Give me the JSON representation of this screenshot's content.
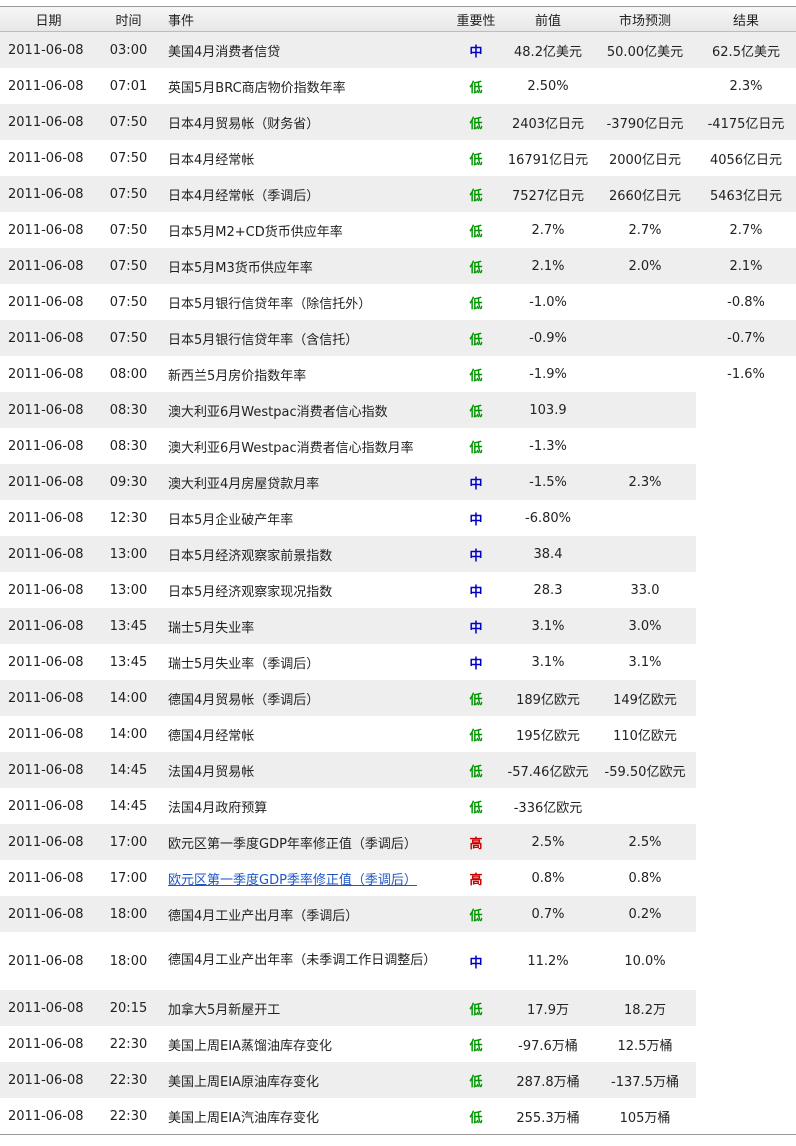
{
  "headers": {
    "date": "日期",
    "time": "时间",
    "event": "事件",
    "importance": "重要性",
    "previous": "前值",
    "forecast": "市场预测",
    "result": "结果"
  },
  "colors": {
    "low": "#009900",
    "medium": "#0000cc",
    "high": "#cc0000",
    "link": "#1e56c8"
  },
  "rows": [
    {
      "date": "2011-06-08",
      "time": "03:00",
      "event": "美国4月消费者信贷",
      "importance": "中",
      "level": "mid",
      "previous": "48.2亿美元",
      "forecast": "50.00亿美元",
      "result": "62.5亿美元"
    },
    {
      "date": "2011-06-08",
      "time": "07:01",
      "event": "英国5月BRC商店物价指数年率",
      "importance": "低",
      "level": "low",
      "previous": "2.50%",
      "forecast": "",
      "result": "2.3%"
    },
    {
      "date": "2011-06-08",
      "time": "07:50",
      "event": "日本4月贸易帐（财务省）",
      "importance": "低",
      "level": "low",
      "previous": "2403亿日元",
      "forecast": "-3790亿日元",
      "result": "-4175亿日元"
    },
    {
      "date": "2011-06-08",
      "time": "07:50",
      "event": "日本4月经常帐",
      "importance": "低",
      "level": "low",
      "previous": "16791亿日元",
      "forecast": "2000亿日元",
      "result": "4056亿日元"
    },
    {
      "date": "2011-06-08",
      "time": "07:50",
      "event": "日本4月经常帐（季调后）",
      "importance": "低",
      "level": "low",
      "previous": "7527亿日元",
      "forecast": "2660亿日元",
      "result": "5463亿日元"
    },
    {
      "date": "2011-06-08",
      "time": "07:50",
      "event": "日本5月M2+CD货币供应年率",
      "importance": "低",
      "level": "low",
      "previous": "2.7%",
      "forecast": "2.7%",
      "result": "2.7%"
    },
    {
      "date": "2011-06-08",
      "time": "07:50",
      "event": "日本5月M3货币供应年率",
      "importance": "低",
      "level": "low",
      "previous": "2.1%",
      "forecast": "2.0%",
      "result": "2.1%"
    },
    {
      "date": "2011-06-08",
      "time": "07:50",
      "event": "日本5月银行信贷年率（除信托外）",
      "importance": "低",
      "level": "low",
      "previous": "-1.0%",
      "forecast": "",
      "result": "-0.8%"
    },
    {
      "date": "2011-06-08",
      "time": "07:50",
      "event": "日本5月银行信贷年率（含信托）",
      "importance": "低",
      "level": "low",
      "previous": "-0.9%",
      "forecast": "",
      "result": "-0.7%"
    },
    {
      "date": "2011-06-08",
      "time": "08:00",
      "event": "新西兰5月房价指数年率",
      "importance": "低",
      "level": "low",
      "previous": "-1.9%",
      "forecast": "",
      "result": "-1.6%"
    },
    {
      "date": "2011-06-08",
      "time": "08:30",
      "event": "澳大利亚6月Westpac消费者信心指数",
      "importance": "低",
      "level": "low",
      "previous": "103.9",
      "forecast": "",
      "result": ""
    },
    {
      "date": "2011-06-08",
      "time": "08:30",
      "event": "澳大利亚6月Westpac消费者信心指数月率",
      "importance": "低",
      "level": "low",
      "previous": "-1.3%",
      "forecast": "",
      "result": ""
    },
    {
      "date": "2011-06-08",
      "time": "09:30",
      "event": "澳大利亚4月房屋贷款月率",
      "importance": "中",
      "level": "mid",
      "previous": "-1.5%",
      "forecast": "2.3%",
      "result": ""
    },
    {
      "date": "2011-06-08",
      "time": "12:30",
      "event": "日本5月企业破产年率",
      "importance": "中",
      "level": "mid",
      "previous": "-6.80%",
      "forecast": "",
      "result": ""
    },
    {
      "date": "2011-06-08",
      "time": "13:00",
      "event": "日本5月经济观察家前景指数",
      "importance": "中",
      "level": "mid",
      "previous": "38.4",
      "forecast": "",
      "result": ""
    },
    {
      "date": "2011-06-08",
      "time": "13:00",
      "event": "日本5月经济观察家现况指数",
      "importance": "中",
      "level": "mid",
      "previous": "28.3",
      "forecast": "33.0",
      "result": ""
    },
    {
      "date": "2011-06-08",
      "time": "13:45",
      "event": "瑞士5月失业率",
      "importance": "中",
      "level": "mid",
      "previous": "3.1%",
      "forecast": "3.0%",
      "result": ""
    },
    {
      "date": "2011-06-08",
      "time": "13:45",
      "event": "瑞士5月失业率（季调后）",
      "importance": "中",
      "level": "mid",
      "previous": "3.1%",
      "forecast": "3.1%",
      "result": ""
    },
    {
      "date": "2011-06-08",
      "time": "14:00",
      "event": "德国4月贸易帐（季调后）",
      "importance": "低",
      "level": "low",
      "previous": "189亿欧元",
      "forecast": "149亿欧元",
      "result": ""
    },
    {
      "date": "2011-06-08",
      "time": "14:00",
      "event": "德国4月经常帐",
      "importance": "低",
      "level": "low",
      "previous": "195亿欧元",
      "forecast": "110亿欧元",
      "result": ""
    },
    {
      "date": "2011-06-08",
      "time": "14:45",
      "event": "法国4月贸易帐",
      "importance": "低",
      "level": "low",
      "previous": "-57.46亿欧元",
      "forecast": "-59.50亿欧元",
      "result": ""
    },
    {
      "date": "2011-06-08",
      "time": "14:45",
      "event": "法国4月政府预算",
      "importance": "低",
      "level": "low",
      "previous": "-336亿欧元",
      "forecast": "",
      "result": ""
    },
    {
      "date": "2011-06-08",
      "time": "17:00",
      "event": "欧元区第一季度GDP年率修正值（季调后）",
      "importance": "高",
      "level": "high",
      "previous": "2.5%",
      "forecast": "2.5%",
      "result": ""
    },
    {
      "date": "2011-06-08",
      "time": "17:00",
      "event": "欧元区第一季度GDP季率修正值（季调后）",
      "importance": "高",
      "level": "high",
      "previous": "0.8%",
      "forecast": "0.8%",
      "result": "",
      "link": true
    },
    {
      "date": "2011-06-08",
      "time": "18:00",
      "event": "德国4月工业产出月率（季调后）",
      "importance": "低",
      "level": "low",
      "previous": "0.7%",
      "forecast": "0.2%",
      "result": ""
    },
    {
      "date": "2011-06-08",
      "time": "18:00",
      "event": "德国4月工业产出年率（未季调工作日调整后）",
      "importance": "中",
      "level": "mid",
      "previous": "11.2%",
      "forecast": "10.0%",
      "result": "",
      "tall": true
    },
    {
      "date": "2011-06-08",
      "time": "20:15",
      "event": "加拿大5月新屋开工",
      "importance": "低",
      "level": "low",
      "previous": "17.9万",
      "forecast": "18.2万",
      "result": ""
    },
    {
      "date": "2011-06-08",
      "time": "22:30",
      "event": "美国上周EIA蒸馏油库存变化",
      "importance": "低",
      "level": "low",
      "previous": "-97.6万桶",
      "forecast": "12.5万桶",
      "result": ""
    },
    {
      "date": "2011-06-08",
      "time": "22:30",
      "event": "美国上周EIA原油库存变化",
      "importance": "低",
      "level": "low",
      "previous": "287.8万桶",
      "forecast": "-137.5万桶",
      "result": ""
    },
    {
      "date": "2011-06-08",
      "time": "22:30",
      "event": "美国上周EIA汽油库存变化",
      "importance": "低",
      "level": "low",
      "previous": "255.3万桶",
      "forecast": "105万桶",
      "result": ""
    }
  ]
}
